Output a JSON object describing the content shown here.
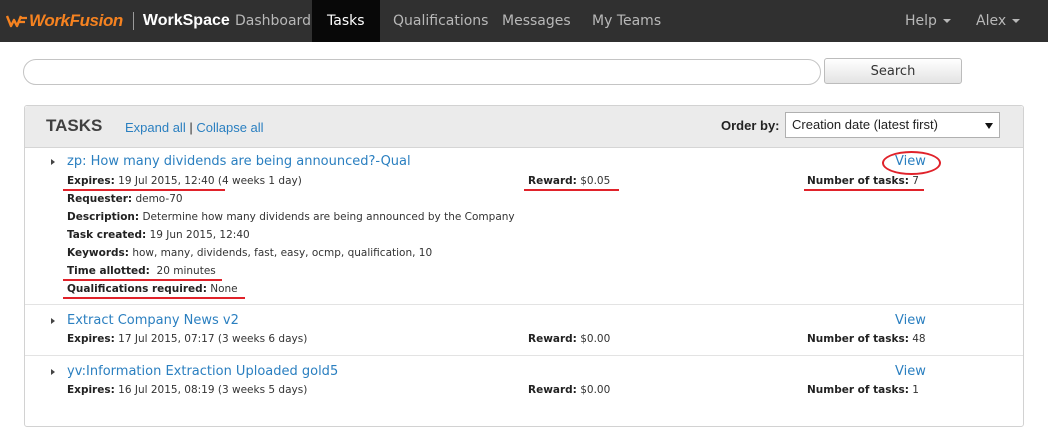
{
  "navbar": {
    "brand": "WorkFusion",
    "product": "WorkSpace",
    "items": [
      {
        "label": "Dashboard"
      },
      {
        "label": "Tasks",
        "active": true
      },
      {
        "label": "Qualifications"
      },
      {
        "label": "Messages"
      },
      {
        "label": "My Teams"
      }
    ],
    "help_label": "Help",
    "user_label": "Alex"
  },
  "search": {
    "value": "",
    "placeholder": "",
    "button_label": "Search"
  },
  "panel": {
    "title": "TASKS",
    "expand_all": "Expand all",
    "separator": "|",
    "collapse_all": "Collapse all",
    "order_label": "Order by:",
    "order_value": "Creation date (latest first)"
  },
  "labels": {
    "expires": "Expires:",
    "reward": "Reward:",
    "number_of_tasks": "Number of tasks:",
    "requester": "Requester:",
    "description": "Description:",
    "task_created": "Task created:",
    "keywords": "Keywords:",
    "time_allotted": "Time allotted:",
    "qualifications_required": "Qualifications required:",
    "view": "View"
  },
  "tasks": [
    {
      "title": "zp: How many dividends are being announced?-Qual",
      "expires": "19 Jul 2015, 12:40",
      "expires_rel": "(4 weeks 1 day)",
      "reward": "$0.05",
      "number_of_tasks": "7",
      "requester": "demo-70",
      "description": "Determine how many dividends are being announced by the Company",
      "task_created": "19 Jun 2015, 12:40",
      "keywords": "how, many, dividends, fast, easy, ocmp, qualification, 10",
      "time_allotted": "20 minutes",
      "qualifications_required": "None"
    },
    {
      "title": "Extract Company News v2",
      "expires": "17 Jul 2015, 07:17",
      "expires_rel": "(3 weeks 6 days)",
      "reward": "$0.00",
      "number_of_tasks": "48"
    },
    {
      "title": "yv:Information Extraction Uploaded gold5",
      "expires": "16 Jul 2015, 08:19",
      "expires_rel": "(3 weeks 5 days)",
      "reward": "$0.00",
      "number_of_tasks": "1"
    }
  ],
  "colors": {
    "brand_orange": "#f58220",
    "link_blue": "#2a7fc0",
    "annotation_red": "#e0222a",
    "navbar_bg": "#303030"
  }
}
